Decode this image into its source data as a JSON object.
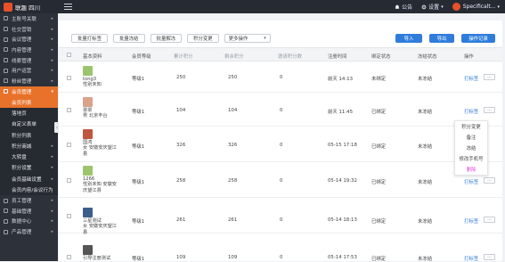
{
  "app": {
    "logo_text": "联趣 四川",
    "notice_label": "公告",
    "settings_label": "设置",
    "user_name": "Specificalt..."
  },
  "sidebar": {
    "items": [
      {
        "label": "主账号关联",
        "icon": "link-icon"
      },
      {
        "label": "社交营销",
        "icon": "share-icon"
      },
      {
        "label": "会议管理",
        "icon": "meeting-icon"
      },
      {
        "label": "内容管理",
        "icon": "document-icon"
      },
      {
        "label": "线索管理",
        "icon": "clue-icon"
      },
      {
        "label": "用户运营",
        "icon": "users-icon"
      },
      {
        "label": "粉丝管理",
        "icon": "fans-icon"
      },
      {
        "label": "会员管理",
        "icon": "member-icon"
      }
    ],
    "subitems": [
      "会员列表",
      "落地页",
      "自定义表单",
      "积分列表",
      "积分商城",
      "大转盘",
      "积分设置",
      "会员基础设置",
      "会员内容/会议行为"
    ],
    "bottom_items": [
      {
        "label": "员工管理",
        "icon": "staff-icon"
      },
      {
        "label": "基础管理",
        "icon": "base-icon"
      },
      {
        "label": "数据中心",
        "icon": "data-icon"
      },
      {
        "label": "产品管理",
        "icon": "product-icon"
      }
    ]
  },
  "toolbar": {
    "buttons": [
      "批量打标签",
      "批量冻结",
      "批量解冻",
      "积分变更"
    ],
    "select_value": "更多操作",
    "import_label": "导入",
    "export_label": "导出",
    "log_label": "操作记录"
  },
  "table": {
    "headers": [
      "基本资料",
      "会员等级",
      "累计积分",
      "剩余积分",
      "邀请积分数",
      "注册时间",
      "绑定状态",
      "冻结状态",
      "操作"
    ],
    "rows": [
      {
        "lines": [
          "tong3",
          "性别未知"
        ],
        "level": "等级1",
        "total": "250",
        "remain": "250",
        "invite": "0",
        "time": "前天 14:13",
        "bind": "未绑定",
        "freeze": "未冻结",
        "action": "打标签",
        "avatar_color": "#9cc46c"
      },
      {
        "lines": [
          "翠翠",
          "男  北京丰台"
        ],
        "level": "等级1",
        "total": "104",
        "remain": "104",
        "invite": "0",
        "time": "前天 11:45",
        "bind": "已绑定",
        "freeze": "未冻结",
        "action": "打标签",
        "avatar_color": "#d9a38a"
      },
      {
        "lines": [
          "国鸿",
          "女  安徽安庆望江",
          "县"
        ],
        "level": "等级1",
        "total": "326",
        "remain": "326",
        "invite": "0",
        "time": "05-15 17:18",
        "bind": "已绑定",
        "freeze": "未冻结",
        "action": "打标签",
        "avatar_color": "#c0563f"
      },
      {
        "lines": [
          "1266",
          "性别未知  安徽安",
          "庆望江县"
        ],
        "level": "等级1",
        "total": "258",
        "remain": "258",
        "invite": "0",
        "time": "05-14 19:32",
        "bind": "已绑定",
        "freeze": "未冻结",
        "action": "打标签",
        "avatar_color": "#9cc46c"
      },
      {
        "lines": [
          "三星测试",
          "女  安徽安庆望江",
          "县"
        ],
        "level": "等级1",
        "total": "261",
        "remain": "261",
        "invite": "0",
        "time": "05-14 18:13",
        "bind": "已绑定",
        "freeze": "未冻结",
        "action": "打标签",
        "avatar_color": "#3d5e8c"
      },
      {
        "lines": [
          "引导注册测试"
        ],
        "level": "等级1",
        "total": "109",
        "remain": "109",
        "invite": "0",
        "time": "05-14 17:53",
        "bind": "已绑定",
        "freeze": "未冻结",
        "action": "打标签",
        "avatar_color": "#555555"
      }
    ]
  },
  "dropdown": {
    "items": [
      "积分变更",
      "备注",
      "冻结",
      "修改手机号",
      "删除"
    ]
  },
  "colors": {
    "accent": "#e8722a",
    "primary": "#2f7ddb",
    "sidebar_bg": "#2d3139",
    "topbar_bg": "#262a33",
    "danger": "#e04bd8"
  }
}
